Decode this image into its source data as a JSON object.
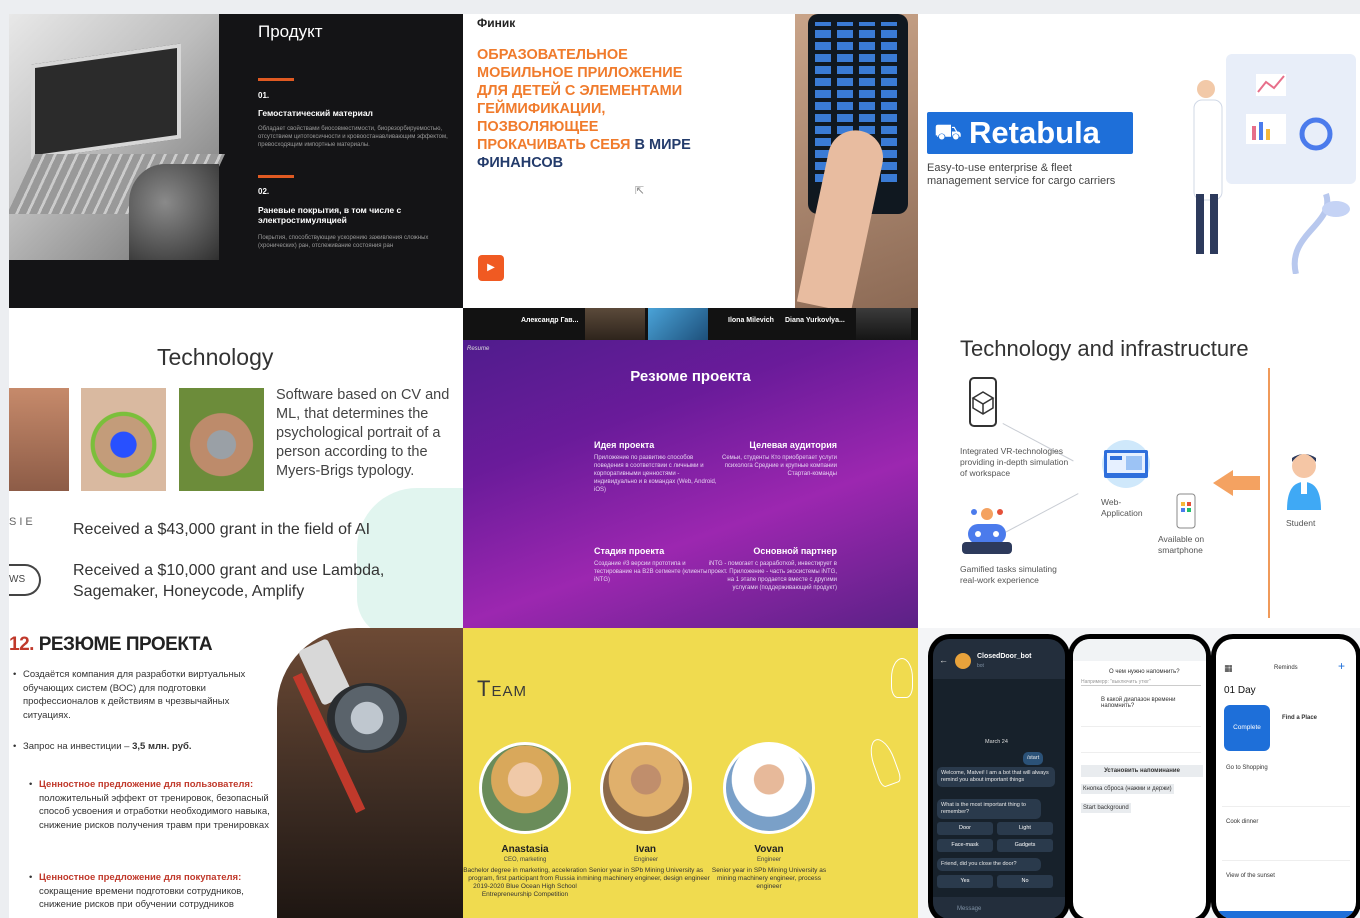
{
  "product": {
    "title": "Продукт",
    "items": [
      {
        "num": "01.",
        "title": "Гемостатический материал",
        "desc": "Обладает свойствами биосовместимости, биорезорбируемостью, отсутствием цитотоксичности и кровоостанавливающим эффектом, превосходящим импортные материалы."
      },
      {
        "num": "02.",
        "title": "Раневые покрытия, в том числе с электростимуляцией",
        "desc": "Покрытия, способствующие ускорению заживления сложных (хронических) ран, отслеживание состояния ран"
      }
    ]
  },
  "finik": {
    "brand": "Финик",
    "headline_orange": "ОБРАЗОВАТЕЛЬНОЕ МОБИЛЬНОЕ ПРИЛОЖЕНИЕ ДЛЯ ДЕТЕЙ С ЭЛЕМЕНТАМИ ГЕЙМИФИКАЦИИ, ПОЗВОЛЯЮЩЕЕ ПРОКАЧИВАТЬ СЕБЯ",
    "headline_dark": "В МИРЕ ФИНАНСОВ",
    "play": "▶"
  },
  "retabula": {
    "logo": "Retabula",
    "tagline": "Easy-to-use enterprise & fleet management service for cargo carriers"
  },
  "technology": {
    "title": "Technology",
    "text": "Software based on CV and ML, that determines the psychological portrait of a person according to the Myers-Brigs typology.",
    "badge1": "SIE",
    "badge2": "WS",
    "grant1": "Received a $43,000 grant in the field of AI",
    "grant2": "Received a $10,000 grant and use Lambda, Sagemaker, Honeycode, Amplify"
  },
  "resume": {
    "video_names": [
      "Александр Гав...",
      "Ilona Milevich",
      "Diana Yurkovlya..."
    ],
    "small_label": "Resume",
    "title": "Резюме проекта",
    "blocks": [
      {
        "h": "Идея проекта",
        "p": "Приложение по развитию способов поведения в соответствии с личными и корпоративными ценностями - индивидуально и в командах (Web, Android, iOS)"
      },
      {
        "h": "Целевая аудитория",
        "p": "Семьи, студенты Кто приобретает услуги психолога Средние и крупные компании Стартап-команды"
      },
      {
        "h": "Стадия проекта",
        "p": "Создание #3 версии прототипа и тестирование на B2B сегменте (клиенты iNTG)"
      },
      {
        "h": "Основной партнер",
        "p": "iNTG - помогает с разработкой, инвестирует в проект. Приложение - часть экосистемы iNTG, на 1 этапе продается вместе с другими услугами (поддерживающий продукт)"
      }
    ]
  },
  "infra": {
    "title": "Technology and infrastructure",
    "vr": "Integrated VR-technologies providing in-depth simulation of workspace",
    "web": "Web-Application",
    "phone": "Available on smartphone",
    "student": "Student",
    "tasks": "Gamified tasks simulating real-work experience"
  },
  "summary": {
    "num": "12.",
    "title": "РЕЗЮМЕ ПРОЕКТА",
    "b1": "Создаётся компания для разработки виртуальных обучающих систем (ВОС) для подготовки профессионалов к действиям в чрезвычайных ситуациях.",
    "b2_label": "Запрос на инвестиции – ",
    "b2_value": "3,5 млн. руб.",
    "b3_head": "Ценностное предложение для пользователя:",
    "b3_body": "положительный эффект от тренировок, безопасный способ усвоения и отработки необходимого навыка, снижение рисков получения травм при тренировках",
    "b4_head": "Ценностное предложение для покупателя:",
    "b4_body": "сокращение времени подготовки сотрудников, снижение рисков при обучении сотрудников"
  },
  "team": {
    "title": "Team",
    "members": [
      {
        "name": "Anastasia",
        "role": "CEO, marketing",
        "bio": "Bachelor degree in marketing, acceleration program, first participant from Russia in 2019-2020 Blue Ocean High School Entrepreneurship Competition"
      },
      {
        "name": "Ivan",
        "role": "Engineer",
        "bio": "Senior year in SPb Mining University as mining machinery engineer, design engineer"
      },
      {
        "name": "Vovan",
        "role": "Engineer",
        "bio": "Senior year in SPb Mining University as mining machinery engineer, process engineer"
      }
    ]
  },
  "phones": {
    "bot_name": "ClosedDoor_bot",
    "bot_sub": "bot",
    "date": "March 24",
    "start": "/start",
    "msg1": "Welcome, Matvei! I am a bot that will always remind you about important things",
    "msg2": "What is the most important thing to remember?",
    "opts": [
      "Door",
      "Light",
      "Face-mask",
      "Gadgets"
    ],
    "msg3": "Friend, did you close the door?",
    "yes": "Yes",
    "no": "No",
    "input": "Message",
    "p2_q1": "О чем нужно напомнить?",
    "p2_a1": "Напримерр: \"выключить утюг\"",
    "p2_q2": "В какой диапазон времени напомнить?",
    "p2_set": "Установить напоминание",
    "p2_reset": "Кнопка сброса (нажми и держи)",
    "p2_bg": "Start background",
    "p3_title": "Reminds",
    "p3_day": "01 Day",
    "p3_complete": "Complete",
    "p3_card0": "Find a Place",
    "p3_items": [
      "Go to Shopping",
      "Cook dinner",
      "View of the sunset"
    ]
  }
}
